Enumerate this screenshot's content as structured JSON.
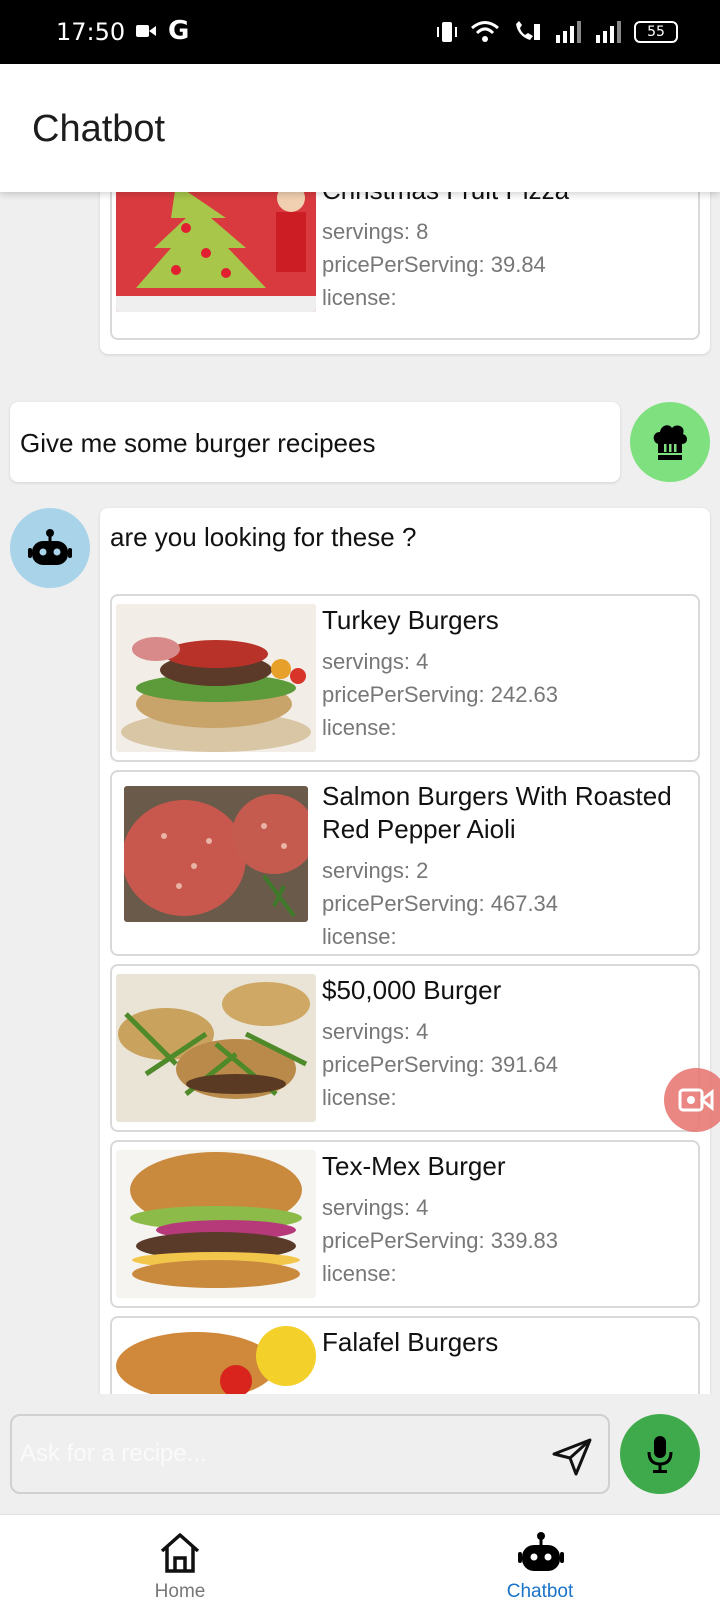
{
  "status_bar": {
    "time": "17:50",
    "battery": "55"
  },
  "header": {
    "title": "Chatbot"
  },
  "previous_card": {
    "title": "Christmas Fruit Pizza",
    "servings": "servings: 8",
    "price": "pricePerServing: 39.84",
    "license": "license:"
  },
  "user_message": {
    "text": "Give me some burger recipees"
  },
  "bot_reply": {
    "greeting": "are you looking for these ?",
    "recipes": [
      {
        "title": "Turkey Burgers",
        "servings": "servings: 4",
        "price": "pricePerServing: 242.63",
        "license": "license:"
      },
      {
        "title": "Salmon Burgers With Roasted Red Pepper Aioli",
        "servings": "servings: 2",
        "price": "pricePerServing: 467.34",
        "license": "license:"
      },
      {
        "title": "$50,000 Burger",
        "servings": "servings: 4",
        "price": "pricePerServing: 391.64",
        "license": "license:"
      },
      {
        "title": "Tex-Mex Burger",
        "servings": "servings: 4",
        "price": "pricePerServing: 339.83",
        "license": "license:"
      },
      {
        "title": "Falafel Burgers",
        "servings": "",
        "price": "",
        "license": ""
      }
    ]
  },
  "input": {
    "placeholder": "Ask for a recipe..."
  },
  "nav": {
    "home_label": "Home",
    "chatbot_label": "Chatbot"
  },
  "colors": {
    "active_tab": "#1a73c8",
    "mic": "#3faa4b",
    "user_avatar": "#7fe07f",
    "bot_avatar": "#a9d3e8"
  },
  "icons": [
    "video-icon",
    "google-icon",
    "chef-hat-icon",
    "robot-icon",
    "send-icon",
    "mic-icon",
    "home-icon",
    "camera-record-icon"
  ]
}
